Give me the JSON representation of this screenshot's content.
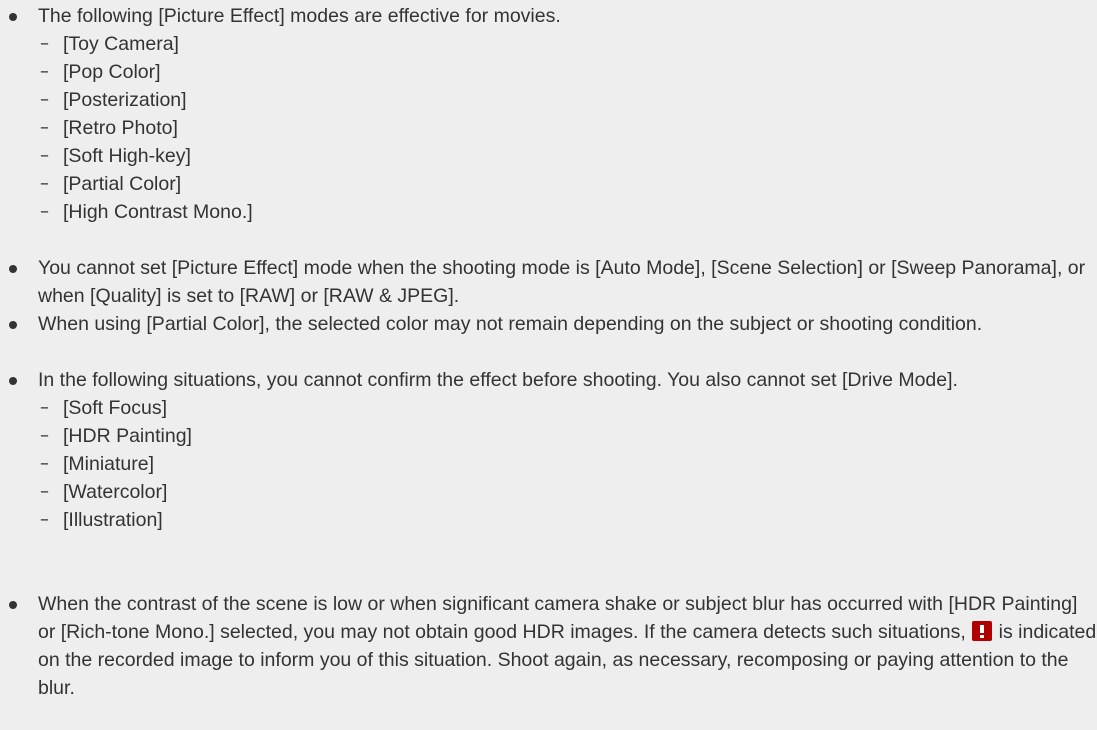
{
  "notes": [
    {
      "text": "The following [Picture Effect] modes are effective for movies.",
      "sub_items": [
        "[Toy Camera]",
        "[Pop Color]",
        "[Posterization]",
        "[Retro Photo]",
        "[Soft High-key]",
        "[Partial Color]",
        "[High Contrast Mono.]"
      ]
    },
    {
      "text": "You cannot set [Picture Effect] mode when the shooting mode is [Auto Mode], [Scene Selection] or [Sweep Panorama], or when [Quality] is set to [RAW] or [RAW & JPEG]."
    },
    {
      "text": "When using [Partial Color], the selected color may not remain depending on the subject or shooting condition."
    },
    {
      "text": "In the following situations, you cannot confirm the effect before shooting. You also cannot set [Drive Mode].",
      "sub_items": [
        "[Soft Focus]",
        "[HDR Painting]",
        "[Miniature]",
        "[Watercolor]",
        "[Illustration]"
      ]
    },
    {
      "text_before_icon": "When the contrast of the scene is low or when significant camera shake or subject blur has occurred with [HDR Painting] or [Rich-tone Mono.] selected, you may not obtain good HDR images. If the camera detects such situations, ",
      "icon": "warning-exclamation-icon",
      "text_after_icon": " is indicated on the recorded image to inform you of this situation. Shoot again, as necessary, recomposing or paying attention to the blur."
    }
  ],
  "colors": {
    "background": "#eeeeee",
    "text": "#333333",
    "warning_icon": "#b00000"
  },
  "dash_glyph": "–"
}
